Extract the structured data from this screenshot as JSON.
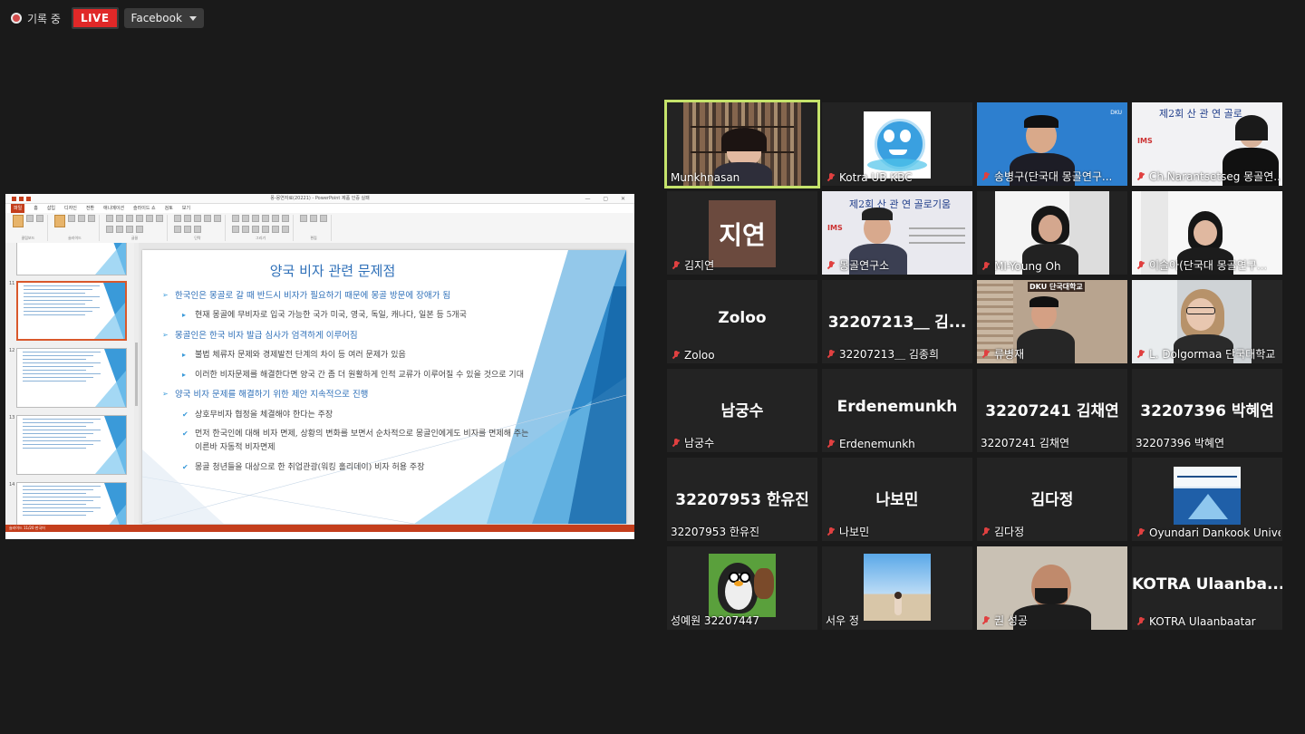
{
  "recording": {
    "label": "기록 중",
    "live_badge": "LIVE",
    "platform": "Facebook"
  },
  "slide": {
    "window_title": "몽-몽연자료(20221) - PowerPoint 제품 인증 실패",
    "tabs": [
      "파일",
      "홈",
      "삽입",
      "디자인",
      "전환",
      "애니메이션",
      "슬라이드 쇼",
      "검토",
      "보기"
    ],
    "title": "양국 비자 관련 문제점",
    "bullets": [
      {
        "level": 1,
        "text": "한국인은 몽골로 갈 때 반드시 비자가 필요하기 때문에 몽골 방문에 장애가 됨"
      },
      {
        "level": 2,
        "text": "현재 몽골에 무비자로 입국 가능한 국가 미국, 영국, 독일, 캐나다, 일본 등 5개국"
      },
      {
        "level": 1,
        "text": "몽골인은 한국 비자 발급 심사가 엄격하게 이루어짐"
      },
      {
        "level": 2,
        "text": "불법 체류자 문제와 경제발전 단계의 차이 등 여러 문제가 있음"
      },
      {
        "level": 2,
        "text": "이러한 비자문제를 해결한다면 양국 간 좀 더 원활하게 인적 교류가 이루어질 수 있을 것으로 기대"
      },
      {
        "level": 1,
        "text": "양국 비자 문제를 해결하기 위한 제안 지속적으로 진행"
      },
      {
        "level": 3,
        "text": "상호무비자 협정을 체결해야 한다는 주장"
      },
      {
        "level": 3,
        "text": "먼저 한국인에 대해 비자 면제, 상황의 변화를 보면서 순차적으로 몽골인에게도 비자를 면제해 주는 이른바 자동적 비자면제"
      },
      {
        "level": 3,
        "text": "몽골 청년들을 대상으로 한 취업관광(워킹 홀리데이) 비자 허용 주장"
      }
    ],
    "thumb_numbers": [
      "11",
      "12",
      "13",
      "14"
    ],
    "status": "슬라이드 11/20  한국어"
  },
  "participants": [
    {
      "name": "Munkhnasan",
      "muted": false,
      "type": "video",
      "active": true
    },
    {
      "name": "Kotra UB KBC",
      "muted": true,
      "type": "logo"
    },
    {
      "name": "송병구(단국대 몽골연구...",
      "muted": true,
      "type": "video"
    },
    {
      "name": "Ch.Narantsetseg 몽골연...",
      "muted": true,
      "type": "video"
    },
    {
      "name": "김지연",
      "muted": true,
      "type": "avatar",
      "avatar_text": "지연"
    },
    {
      "name": "몽골연구소",
      "muted": true,
      "type": "video"
    },
    {
      "name": "MI-Young Oh",
      "muted": true,
      "type": "video"
    },
    {
      "name": "이슬아(단국대 몽골연구...",
      "muted": true,
      "type": "video"
    },
    {
      "name": "Zoloo",
      "muted": true,
      "type": "text",
      "big": "Zoloo"
    },
    {
      "name": "32207213＿ 김종희",
      "muted": true,
      "type": "text",
      "big": "32207213＿ 김..."
    },
    {
      "name": "류병재",
      "muted": true,
      "type": "video"
    },
    {
      "name": "L. Dolgormaa 단국대학교",
      "muted": true,
      "type": "video"
    },
    {
      "name": "남궁수",
      "muted": true,
      "type": "text",
      "big": "남궁수"
    },
    {
      "name": "Erdenemunkh",
      "muted": true,
      "type": "text",
      "big": "Erdenemunkh"
    },
    {
      "name": "32207241 김채연",
      "muted": false,
      "type": "text",
      "big": "32207241 김채연"
    },
    {
      "name": "32207396 박혜연",
      "muted": false,
      "type": "text",
      "big": "32207396 박혜연"
    },
    {
      "name": "32207953 한유진",
      "muted": false,
      "type": "text",
      "big": "32207953 한유진"
    },
    {
      "name": "나보민",
      "muted": true,
      "type": "text",
      "big": "나보민"
    },
    {
      "name": "김다정",
      "muted": true,
      "type": "text",
      "big": "김다정"
    },
    {
      "name": "Oyundari Dankook Unive...",
      "muted": true,
      "type": "logo2"
    },
    {
      "name": "성예원 32207447",
      "muted": false,
      "type": "penguin"
    },
    {
      "name": "서우 정",
      "muted": false,
      "type": "photo"
    },
    {
      "name": "권 성공",
      "muted": true,
      "type": "video"
    },
    {
      "name": "KOTRA Ulaanbaatar",
      "muted": true,
      "type": "text",
      "big": "KOTRA  Ulaanba..."
    }
  ],
  "colors": {
    "live": "#e02828",
    "active_speaker": "#c5e36b",
    "accent": "#2d6fb8",
    "ppt": "#c43e1c"
  }
}
